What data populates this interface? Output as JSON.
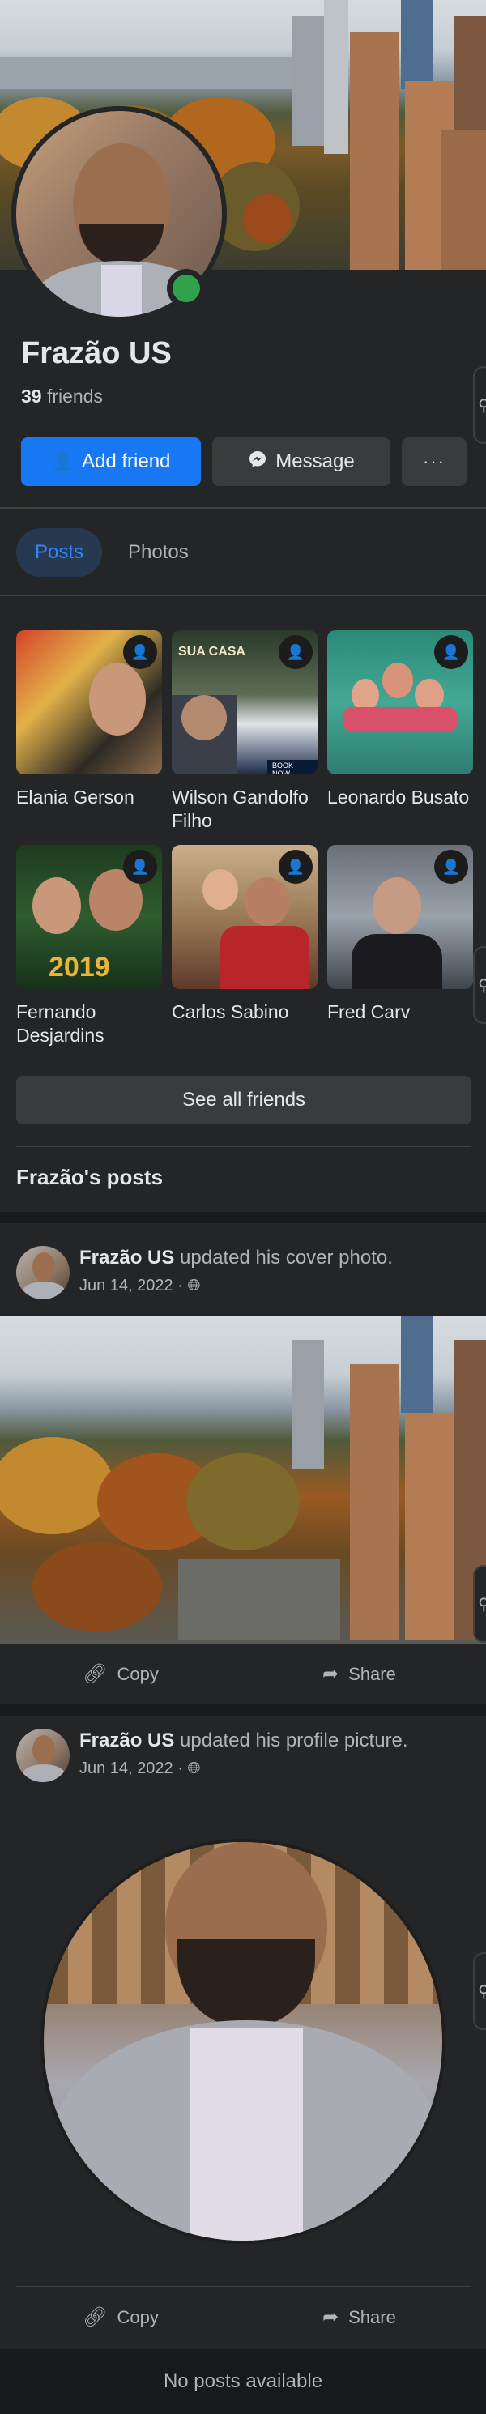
{
  "profile": {
    "name": "Frazão US",
    "friends_count": "39",
    "friends_label": "friends"
  },
  "actions": {
    "add_friend": "Add friend",
    "message": "Message",
    "more": "···"
  },
  "tabs": [
    {
      "label": "Posts",
      "active": true
    },
    {
      "label": "Photos",
      "active": false
    }
  ],
  "friends": [
    {
      "name": "Elania Gerson"
    },
    {
      "name": "Wilson Gandolfo Filho"
    },
    {
      "name": "Leonardo Busato"
    },
    {
      "name": "Fernando Desjardins"
    },
    {
      "name": "Carlos Sabino"
    },
    {
      "name": "Fred Carv"
    }
  ],
  "friend_photo_text": {
    "wilson_headline": "SUA CASA",
    "wilson_button": "BOOK NOW",
    "fernando_year": "2019"
  },
  "see_all_friends": "See all friends",
  "posts_section_title": "Frazão's posts",
  "posts": [
    {
      "author": "Frazão US",
      "action_text": "updated his cover photo.",
      "date": "Jun 14, 2022 ·",
      "copy_label": "Copy",
      "share_label": "Share"
    },
    {
      "author": "Frazão US",
      "action_text": "updated his profile picture.",
      "date": "Jun 14, 2022 ·",
      "copy_label": "Copy",
      "share_label": "Share"
    }
  ],
  "no_posts": "No posts available",
  "colors": {
    "background": "#242526",
    "primary": "#1877f2",
    "online": "#31a24c",
    "secondary_button": "#3a3b3c"
  }
}
